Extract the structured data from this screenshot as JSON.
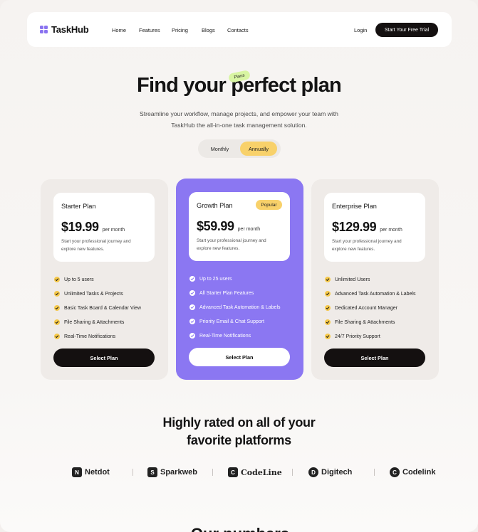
{
  "nav": {
    "logo": "TaskHub",
    "links": [
      "Home",
      "Features",
      "Pricing",
      "Blogs",
      "Contacts"
    ],
    "login": "Login",
    "cta": "Start Your Free Trial"
  },
  "hero": {
    "title": "Find your perfect plan",
    "tag": "Plans",
    "subtitle_line1": "Streamline your workflow, manage projects, and empower your team with",
    "subtitle_line2": "TaskHub the all-in-one task management solution.",
    "toggle": {
      "monthly": "Monthly",
      "annually": "Annually",
      "selected": "Annually"
    }
  },
  "plans": [
    {
      "name": "Starter Plan",
      "price": "$19.99",
      "period": "per month",
      "description": "Start your professional journey and explore new features.",
      "features": [
        "Up to 5 users",
        "Unlimited Tasks & Projects",
        "Basic Task Board & Calendar View",
        "File Sharing & Attachments",
        "Real-Time Notifications"
      ],
      "button": "Select Plan"
    },
    {
      "name": "Growth Plan",
      "badge": "Popular",
      "price": "$59.99",
      "period": "per month",
      "description": "Start your professional journey and explore new features.",
      "features": [
        "Up to 25 users",
        "All Starter Plan Features",
        "Advanced Task Automation & Labels",
        "Priority Email & Chat Support",
        "Real-Time Notifications"
      ],
      "button": "Select Plan"
    },
    {
      "name": "Enterprise Plan",
      "price": "$129.99",
      "period": "per month",
      "description": "Start your professional journey and explore new features.",
      "features": [
        "Unlimited Users",
        "Advanced Task Automation & Labels",
        "Dedicated Account Manager",
        "File Sharing & Attachments",
        "24/7 Priority Support"
      ],
      "button": "Select Plan"
    }
  ],
  "rated": {
    "line1": "Highly rated on all of your",
    "line2": "favorite platforms"
  },
  "brands": [
    "Netdot",
    "Sparkweb",
    "CodeLine",
    "Digitech",
    "Codelink"
  ],
  "bottom_heading_partial": "Our numbers",
  "colors": {
    "accent": "#8b77f2",
    "yellow": "#f8d16a",
    "dark": "#141010",
    "green_tag": "#d8f5a2"
  }
}
